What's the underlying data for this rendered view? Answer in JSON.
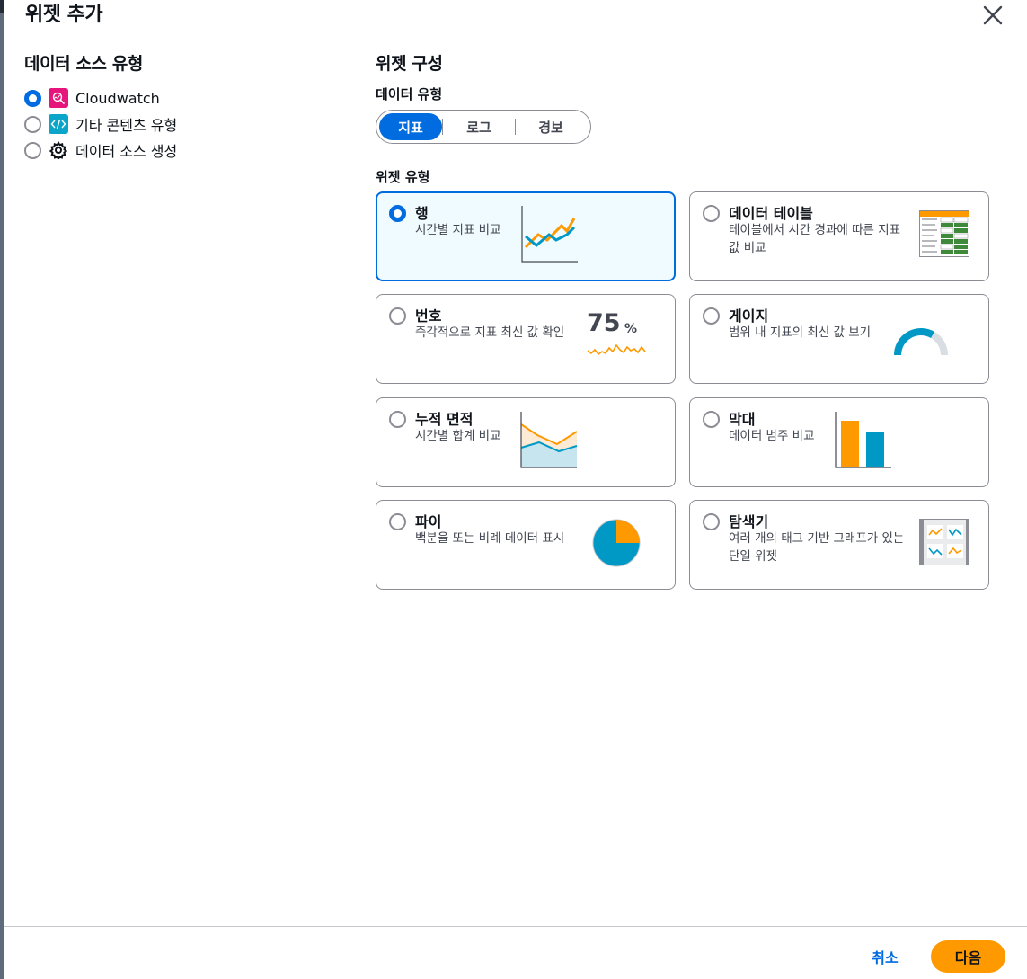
{
  "dialog": {
    "title": "위젯 추가"
  },
  "data_source": {
    "heading": "데이터 소스 유형",
    "options": [
      {
        "label": "Cloudwatch",
        "icon": "cloudwatch-icon",
        "selected": true
      },
      {
        "label": "기타 콘텐츠 유형",
        "icon": "code-icon",
        "selected": false
      },
      {
        "label": "데이터 소스 생성",
        "icon": "gear-icon",
        "selected": false
      }
    ]
  },
  "config": {
    "heading": "위젯 구성",
    "data_type_label": "데이터 유형",
    "data_types": [
      {
        "label": "지표",
        "active": true
      },
      {
        "label": "로그",
        "active": false
      },
      {
        "label": "경보",
        "active": false
      }
    ],
    "widget_type_label": "위젯 유형",
    "widget_types": [
      {
        "title": "행",
        "desc": "시간별 지표 비교",
        "selected": true,
        "art": "line-chart"
      },
      {
        "title": "데이터 테이블",
        "desc": "테이블에서 시간 경과에 따른 지표 값 비교",
        "selected": false,
        "art": "data-table"
      },
      {
        "title": "번호",
        "desc": "즉각적으로 지표 최신 값 확인",
        "selected": false,
        "art": "number",
        "art_number": "75",
        "art_unit": "%"
      },
      {
        "title": "게이지",
        "desc": "범위 내 지표의 최신 값 보기",
        "selected": false,
        "art": "gauge"
      },
      {
        "title": "누적 면적",
        "desc": "시간별 합계 비교",
        "selected": false,
        "art": "stacked-area"
      },
      {
        "title": "막대",
        "desc": "데이터 범주 비교",
        "selected": false,
        "art": "bar-chart"
      },
      {
        "title": "파이",
        "desc": "백분율 또는 비례 데이터 표시",
        "selected": false,
        "art": "pie-chart"
      },
      {
        "title": "탐색기",
        "desc": "여러 개의 태그 기반 그래프가 있는 단일 위젯",
        "selected": false,
        "art": "explorer"
      }
    ]
  },
  "footer": {
    "cancel_label": "취소",
    "next_label": "다음"
  },
  "colors": {
    "accent": "#006ce0",
    "primary_button": "#ff9900",
    "chart_orange": "#ff9900",
    "chart_teal": "#0099c6"
  }
}
